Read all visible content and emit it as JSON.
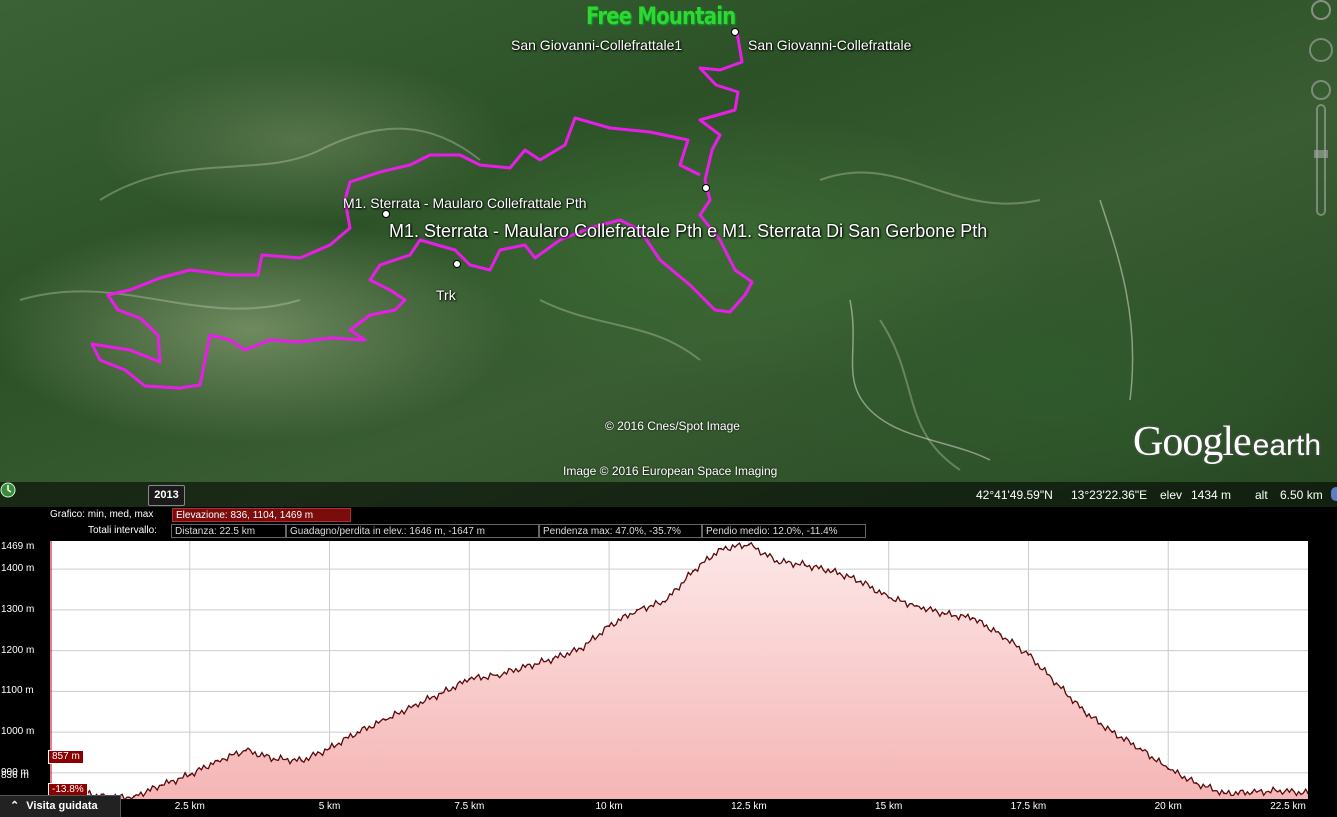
{
  "brand": {
    "title": "Free Mountain"
  },
  "map": {
    "labels": {
      "place1": "San Giovanni-Collefrattale1",
      "place2": "San Giovanni-Collefrattale",
      "path1": "M1. Sterrata - Maularo Collefrattale Pth",
      "path2": "M1. Sterrata - Maularo Collefrattale Pth e M1. Sterrata Di San Gerbone Pth",
      "trk": "Trk"
    },
    "credits": {
      "cnes": "© 2016 Cnes/Spot Image",
      "image": "Image © 2016 European Space Imaging"
    },
    "logo": {
      "google": "Google",
      "earth": "earth"
    },
    "track_color": "#e81ee8"
  },
  "status": {
    "year": "2013",
    "lat": "42°41'49.59\"N",
    "lon": "13°23'22.36\"E",
    "elev_label": "elev",
    "elev_value": "1434 m",
    "alt_label": "alt",
    "alt_value": "6.50 km"
  },
  "profile": {
    "header": {
      "graph_label": "Grafico: min, med, max",
      "elevation": "Elevazione: 836, 1104, 1469 m",
      "totals_label": "Totali intervallo:",
      "distance": "Distanza: 22.5 km",
      "gain_loss": "Guadagno/perdita in elev.: 1646 m, -1647 m",
      "max_slope": "Pendenza max: 47.0%, -35.7%",
      "avg_slope": "Pendio medio: 12.0%, -11.4%"
    },
    "y_labels": [
      "1469 m",
      "1400 m",
      "1300 m",
      "1200 m",
      "1100 m",
      "1000 m",
      "900 m",
      "836 m"
    ],
    "x_labels": [
      "2.5 km",
      "5 km",
      "7.5 km",
      "10 km",
      "12.5 km",
      "15 km",
      "17.5 km",
      "20 km",
      "22.5 km"
    ],
    "cursor_elev": "857 m",
    "cursor_slope": "-13.8%",
    "tour_button": "Visita guidata",
    "fill_color": "#f5b5b5",
    "line_color": "#5a0a0a"
  },
  "chart_data": {
    "type": "area",
    "title": "",
    "xlabel": "",
    "ylabel": "",
    "xlim": [
      0,
      22.5
    ],
    "ylim": [
      836,
      1469
    ],
    "x": [
      0,
      0.5,
      1,
      1.5,
      2,
      2.5,
      3,
      3.5,
      4,
      4.5,
      5,
      5.5,
      6,
      6.5,
      7,
      7.5,
      8,
      8.5,
      9,
      9.5,
      10,
      10.5,
      11,
      11.5,
      12,
      12.5,
      13,
      13.5,
      14,
      14.5,
      15,
      15.5,
      16,
      16.5,
      17,
      17.5,
      18,
      18.5,
      19,
      19.5,
      20,
      20.5,
      21,
      21.5,
      22,
      22.5
    ],
    "y": [
      857,
      855,
      840,
      842,
      870,
      895,
      930,
      955,
      935,
      930,
      960,
      1000,
      1030,
      1065,
      1095,
      1130,
      1140,
      1160,
      1180,
      1205,
      1260,
      1300,
      1320,
      1395,
      1450,
      1460,
      1420,
      1410,
      1395,
      1370,
      1330,
      1310,
      1290,
      1280,
      1240,
      1190,
      1120,
      1050,
      1000,
      960,
      910,
      875,
      850,
      852,
      857,
      850
    ]
  }
}
